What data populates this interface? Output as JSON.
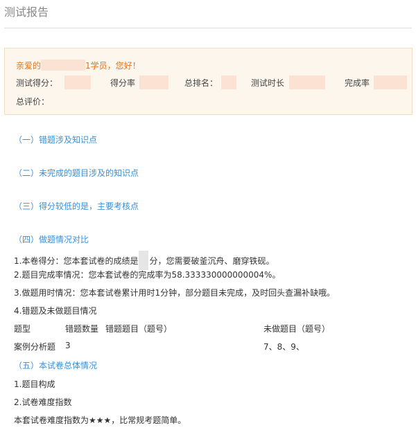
{
  "page": {
    "title": "测试报告"
  },
  "summary": {
    "greeting_prefix": "亲爱的",
    "greeting_suffix": "1学员，您好！",
    "stats": {
      "score_label": "测试得分：",
      "rate_label": "得分率",
      "rank_label": "总排名：",
      "duration_label": "测试时长",
      "completion_label": "完成率"
    },
    "overall_label": "总评价："
  },
  "sections": {
    "s1": "（一）错题涉及知识点",
    "s2": "（二）未完成的题目涉及的知识点",
    "s3": "（三）得分较低的是，主要考核点",
    "s4": "（四）做题情况对比",
    "s5": "（五）本试卷总体情况"
  },
  "comparison": {
    "line1_prefix": "1.本卷得分：您本套试卷的成绩是",
    "line1_suffix": "分，您需要破釜沉舟、磨穿铁砚。",
    "line2": "2.题目完成率情况：您本套试卷的完成率为58.333330000000004%。",
    "line3": "3.做题用时情况：您本套试卷累计用时1分钟，部分题目未完成，及时回头查漏补缺哦。",
    "line4": "4.错题及未做题目情况"
  },
  "table": {
    "headers": {
      "type": "题型",
      "wrong_count": "错题数量",
      "wrong_items": "错题题目（题号）",
      "undone_items": "未做题目（题号）"
    },
    "rows": [
      {
        "type": "案例分析题",
        "wrong_count": "3",
        "wrong_items": "",
        "undone_items": "7、8、9、"
      }
    ]
  },
  "overview": {
    "line1": "1.题目构成",
    "line2": "2.试卷难度指数",
    "line3": "本套试卷难度指数为★★★，比常规考题简单。"
  },
  "colors": {
    "accent_blue": "#3a8fd8",
    "accent_orange": "#e8731c",
    "box_bg": "#fdf6ec"
  }
}
